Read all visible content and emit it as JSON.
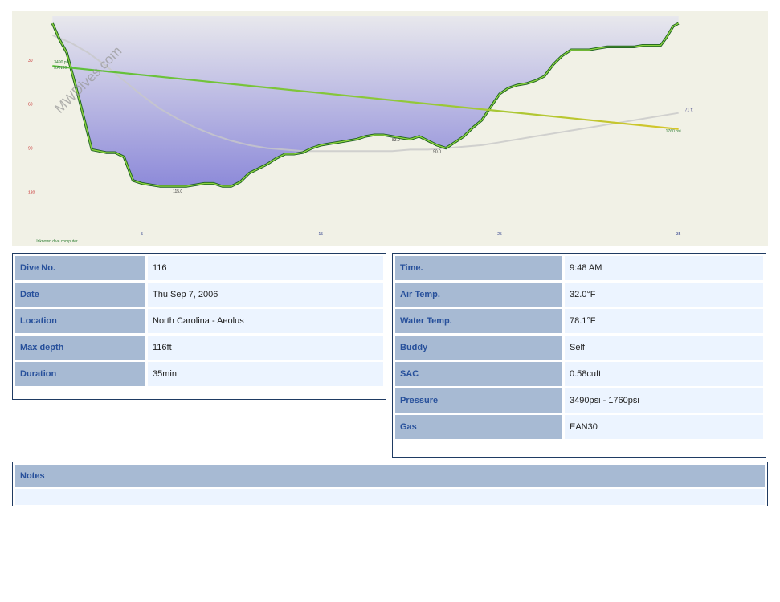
{
  "chart_data": {
    "type": "line",
    "watermark": "MWDives.com",
    "device": "Unknown dive computer",
    "x_ticks": [
      "5",
      "15",
      "25",
      "35"
    ],
    "y_ticks": [
      "30",
      "60",
      "90",
      "120"
    ],
    "xlim": [
      -1,
      40
    ],
    "ylim": [
      0,
      140
    ],
    "depth_x": [
      0,
      0.4,
      0.8,
      1.5,
      2.2,
      2.6,
      3.0,
      3.5,
      4.0,
      4.5,
      5.0,
      5.5,
      6.0,
      6.5,
      7.0,
      7.5,
      8.0,
      8.5,
      9.0,
      9.5,
      10.0,
      10.5,
      11.0,
      11.5,
      12.0,
      12.5,
      13.0,
      13.5,
      14.0,
      14.5,
      15.0,
      15.5,
      16.0,
      16.5,
      17.0,
      17.5,
      18.0,
      18.5,
      19.0,
      19.5,
      20.0,
      20.5,
      21.0,
      21.5,
      22.0,
      22.5,
      23.0,
      23.5,
      24.0,
      24.5,
      25.0,
      25.5,
      26.0,
      26.5,
      27.0,
      27.5,
      28.0,
      28.5,
      29.0,
      29.5,
      30.0,
      30.5,
      31.0,
      31.5,
      32.0,
      32.5,
      33.0,
      33.5,
      34.0,
      34.3,
      34.7,
      35.0
    ],
    "depth": [
      5,
      16,
      25,
      57,
      91,
      92,
      93,
      93,
      96,
      112,
      114,
      115,
      116,
      116,
      116,
      116,
      115,
      114,
      114,
      116,
      116,
      113,
      107,
      104,
      101,
      97,
      94,
      94,
      93,
      90,
      88,
      87,
      86,
      85,
      84,
      82,
      81,
      81,
      82,
      83,
      84,
      82,
      85,
      88,
      90,
      86,
      82,
      76,
      71,
      62,
      53,
      49,
      47,
      46,
      44,
      41,
      33,
      27,
      23,
      23,
      23,
      22,
      21,
      21,
      21,
      21,
      20,
      20,
      20,
      15,
      7,
      5
    ],
    "pressure_x": [
      0,
      35
    ],
    "pressure": [
      3490,
      1760
    ],
    "pressure_start_label": "3490 psi",
    "pressure_end_label": "1760 psi",
    "gas_label": "EAN30",
    "ceiling_x": [
      0,
      1,
      2,
      3,
      4,
      5,
      6,
      7,
      8,
      9,
      10,
      11,
      12,
      13,
      14,
      15,
      16,
      17,
      18,
      19,
      20,
      21,
      22,
      23,
      24,
      25,
      26,
      27,
      28,
      29,
      30,
      31,
      32,
      33,
      34,
      35
    ],
    "ceiling": [
      13,
      18,
      25,
      34,
      44,
      54,
      63,
      70,
      76,
      81,
      85,
      88,
      90,
      91,
      92,
      92,
      92,
      92,
      92,
      92,
      91,
      91,
      90,
      89,
      88,
      86,
      84,
      82,
      80,
      78,
      76,
      74,
      72,
      70,
      68,
      66
    ],
    "ceiling_end_label": "71 ft",
    "annotations": [
      {
        "x": 7,
        "depth": 116,
        "label": "115.0"
      },
      {
        "x": 19.2,
        "depth": 81,
        "label": "83.0"
      },
      {
        "x": 21.5,
        "depth": 89,
        "label": "90.0"
      }
    ]
  },
  "dive": [
    {
      "label": "Dive No.",
      "value": "116"
    },
    {
      "label": "Date",
      "value": "Thu Sep 7, 2006"
    },
    {
      "label": "Location",
      "value": "North Carolina - Aeolus"
    },
    {
      "label": "Max depth",
      "value": "116ft"
    },
    {
      "label": "Duration",
      "value": "35min"
    }
  ],
  "conditions": [
    {
      "label": "Time.",
      "value": "9:48 AM"
    },
    {
      "label": "Air Temp.",
      "value": "32.0°F"
    },
    {
      "label": "Water Temp.",
      "value": "78.1°F"
    },
    {
      "label": "Buddy",
      "value": "Self"
    },
    {
      "label": "SAC",
      "value": "0.58cuft"
    },
    {
      "label": "Pressure",
      "value": "3490psi - 1760psi"
    },
    {
      "label": "Gas",
      "value": "EAN30"
    }
  ],
  "notes": {
    "title": "Notes",
    "body": ""
  },
  "colors": {
    "profile_fill_top": "#e8e8ed",
    "profile_fill_bottom": "#8d8ad9",
    "background": "#f1f1e6",
    "depth_outline": "#1b5e20",
    "depth_highlight": "#8cd43f",
    "pressure_line": "#5bbf3a",
    "pressure_line_end": "#d6c62a",
    "ceiling_line": "#c8c8c8",
    "label_bg": "#a7bad3",
    "label_text": "#27509b",
    "value_bg": "#ecf4ff"
  }
}
